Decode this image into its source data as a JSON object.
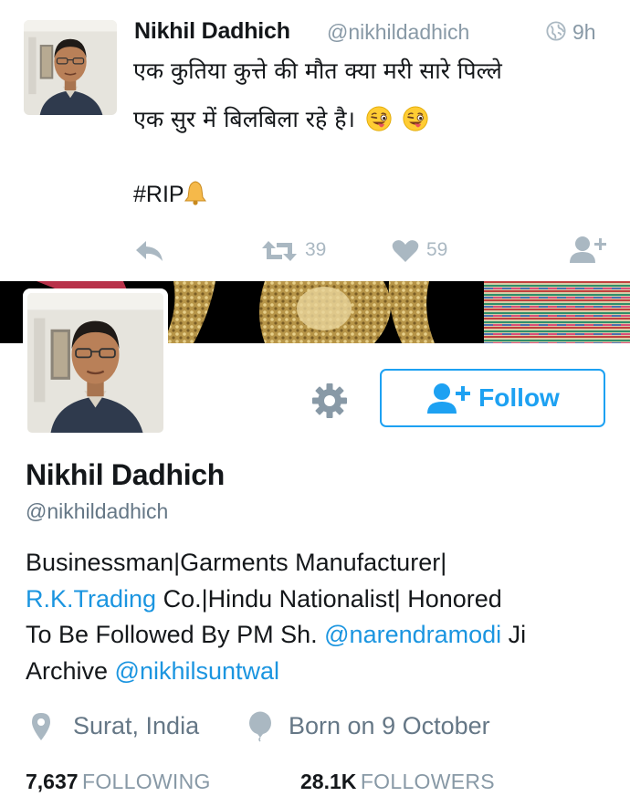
{
  "tweet": {
    "author_name": "Nikhil Dadhich",
    "author_handle": "@nikhildadhich",
    "time": "9h",
    "text_line1": "एक कुतिया कुत्ते की मौत क्या मरी सारे पिल्ले",
    "text_line2": "एक सुर में बिलबिला रहे है।",
    "hashtag": "#RIP",
    "retweet_count": "39",
    "like_count": "59",
    "icons": [
      "globe-icon",
      "winking-face-emoji",
      "bell-emoji",
      "reply-icon",
      "retweet-icon",
      "heart-icon",
      "follow-user-icon"
    ]
  },
  "profile": {
    "name": "Nikhil Dadhich",
    "handle": "@nikhildadhich",
    "follow_label": "Follow",
    "bio": {
      "line1": "Businessman|Garments Manufacturer|",
      "line2_link": "R.K.Trading",
      "line2_rest": " Co.|Hindu Nationalist| Honored",
      "line3_text": "To Be Followed By PM Sh. ",
      "line3_mention": "@narendramodi",
      "line3_end": " Ji",
      "line4_text": "Archive ",
      "line4_mention": "@nikhilsuntwal"
    },
    "location": "Surat, India",
    "birthday": "Born on 9 October",
    "following_count": "7,637",
    "following_label": "FOLLOWING",
    "followers_count": "28.1K",
    "followers_label": "FOLLOWERS",
    "icons": [
      "gear-icon",
      "add-user-icon",
      "location-pin-icon",
      "balloon-icon"
    ]
  },
  "colors": {
    "accent": "#1da1f2",
    "link": "#1b95e0",
    "muted_text": "#657786",
    "icon_gray": "#aab8c2"
  }
}
